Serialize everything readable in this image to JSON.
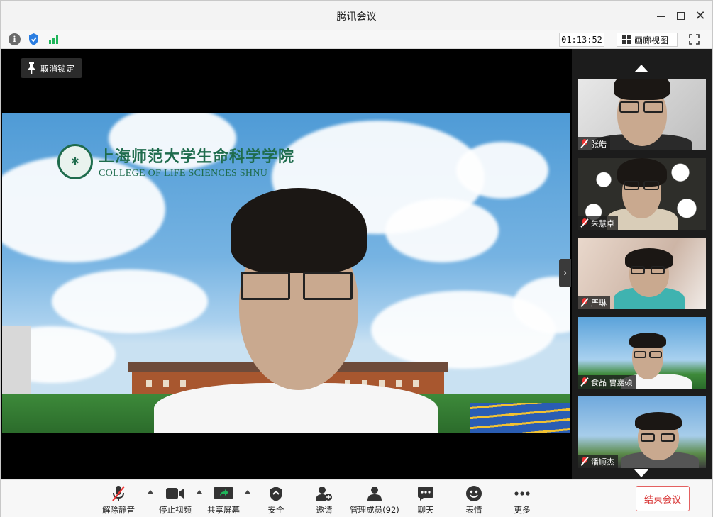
{
  "window": {
    "title": "腾讯会议"
  },
  "infobar": {
    "timer": "01:13:52",
    "gallery_label": "画廊视图",
    "icons": [
      "info-icon",
      "shield-icon",
      "signal-icon",
      "fullscreen-icon"
    ]
  },
  "stage": {
    "unlock_label": "取消锁定",
    "logo_cn": "上海师范大学生命科学学院",
    "logo_en": "COLLEGE OF LIFE SCIENCES SHNU"
  },
  "participants": [
    {
      "name": "张皓",
      "muted": true
    },
    {
      "name": "朱慧卓",
      "muted": true
    },
    {
      "name": "严琳",
      "muted": true
    },
    {
      "name": "食品 曹嘉硕",
      "muted": true
    },
    {
      "name": "潘顺杰",
      "muted": true
    }
  ],
  "toolbar": {
    "mute_label": "解除静音",
    "video_label": "停止视频",
    "share_label": "共享屏幕",
    "security_label": "安全",
    "invite_label": "邀请",
    "members_label": "管理成员(92)",
    "chat_label": "聊天",
    "reactions_label": "表情",
    "more_label": "更多",
    "end_label": "结束会议"
  },
  "colors": {
    "end": "#d93737",
    "signal": "#1fb55a",
    "shield": "#2a7de1",
    "mic_off": "#e33333"
  }
}
